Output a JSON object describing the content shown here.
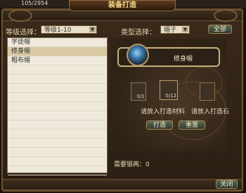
{
  "top": {
    "value": "105/2954"
  },
  "window": {
    "title": "装备打造"
  },
  "filters": {
    "level_label": "等级选择：",
    "level_value": "等级1-10",
    "type_label": "类型选择：",
    "type_value": "帽子",
    "all_button": "全部"
  },
  "list": {
    "items": [
      "学徒帽",
      "修身帽",
      "粗布帽"
    ],
    "selected_index": 1
  },
  "item": {
    "name": "修身帽",
    "icon": "hat-icon"
  },
  "materials": {
    "slot1_count": "0/1",
    "slot2_count": "0/12",
    "slot1_label": "请放入打造材料",
    "slot2_label": "请放入打造石"
  },
  "buttons": {
    "forge": "打造",
    "reset": "重置",
    "close": "关闭"
  },
  "need": {
    "text": "需要银两：0"
  }
}
